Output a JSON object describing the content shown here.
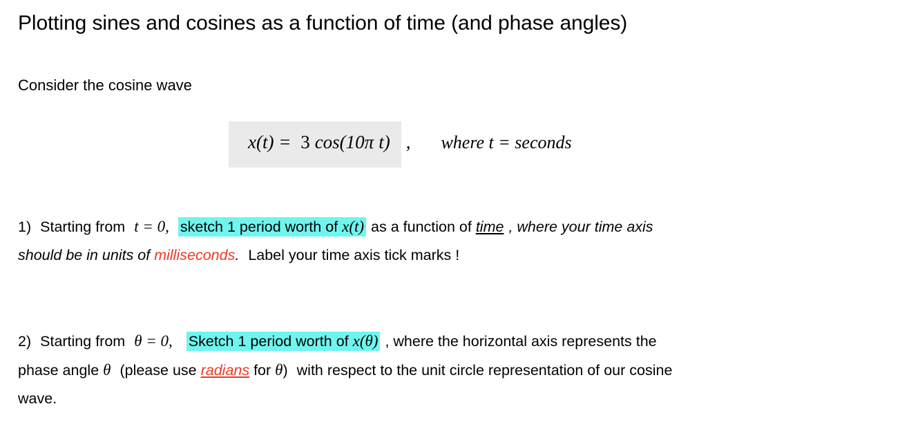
{
  "slide": {
    "title": "Plotting sines and cosines as a function of time  (and phase angles)",
    "lead_in": "Consider the cosine wave",
    "equation": {
      "boxed_lhs": "x(t) = ",
      "boxed_amplitude": "3",
      "boxed_cos_open": "cos(10",
      "boxed_pi": "π",
      "boxed_var": "t)",
      "comma": ",",
      "where_text": "where t = seconds",
      "box_fill_color": "#eaeaea"
    },
    "items": [
      {
        "number": "1)",
        "segments_line1": {
          "starting_from": "Starting from",
          "math_condition": "t = 0,",
          "highlight_before_math": "sketch 1 period worth of ",
          "highlight_math": "x(t)",
          "after_highlight": "as a function of ",
          "underlined_italic": "time",
          "italic_tail": ", where your time axis"
        },
        "segments_line2": {
          "italic_head": "should be in units of ",
          "red_italic": "milliseconds",
          "period": ".",
          "tail": "Label your time axis tick marks !"
        }
      },
      {
        "number": "2)",
        "segments_line1": {
          "starting_from": "Starting from",
          "math_condition": "θ = 0,",
          "highlight_before_math": "Sketch 1 period worth of ",
          "highlight_math": "x(θ)",
          "after_highlight": ", where the horizontal axis represents the"
        },
        "segments_line2": {
          "head": "phase angle ",
          "math_theta": "θ",
          "paren_open": "(please use ",
          "red_underline_italic": "radians",
          "for_text": " for ",
          "math_theta2": "θ",
          "paren_close": ")",
          "tail": "with respect to the unit circle representation of our cosine"
        },
        "segments_line3": {
          "text": "wave."
        }
      }
    ],
    "colors": {
      "highlight_cyan": "#6ff5ee",
      "accent_red": "#ec3a23",
      "equation_box_gray": "#eaeaea",
      "text_black": "#000000",
      "background": "#ffffff"
    }
  }
}
